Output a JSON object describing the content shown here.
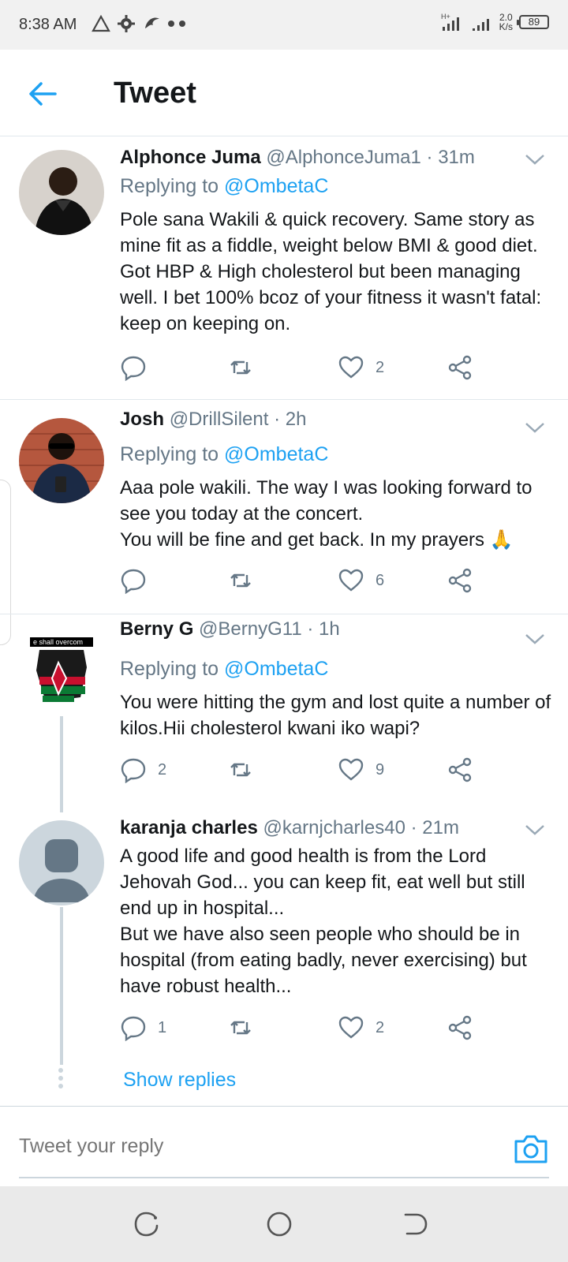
{
  "status_bar": {
    "time": "8:38 AM",
    "network": "H+",
    "speed_value": "2.0",
    "speed_unit": "K/s",
    "battery": "89"
  },
  "header": {
    "title": "Tweet",
    "back_icon": "arrow-left-icon"
  },
  "replying_label": "Replying to",
  "tweets": [
    {
      "name": "Alphonce Juma",
      "handle": "@AlphonceJuma1",
      "time": "· 31m",
      "mention": "@OmbetaC",
      "text": "Pole sana Wakili & quick recovery. Same story as mine fit as a fiddle, weight below BMI & good diet. Got HBP & High cholesterol but been managing well. I bet 100% bcoz of your fitness it wasn't fatal: keep on keeping on.",
      "replies": "",
      "likes": "2"
    },
    {
      "name": "Josh",
      "handle": "@DrillSilent",
      "time": "· 2h",
      "mention": "@OmbetaC",
      "text": "Aaa pole wakili. The way I was looking forward to see you today at the concert.\nYou will be fine and get back.  In my prayers 🙏",
      "replies": "",
      "likes": "6"
    },
    {
      "name": "Berny G",
      "handle": "@BernyG11",
      "time": "· 1h",
      "mention": "@OmbetaC",
      "avatar_caption": "e shall overcom",
      "text": "You were hitting the gym and lost quite a number of kilos.Hii cholesterol kwani iko wapi?",
      "replies": "2",
      "likes": "9"
    },
    {
      "name": "karanja charles",
      "handle": "@karnjcharles40",
      "time": "· 21m",
      "text": "A good life and good health is from the Lord Jehovah God... you can keep fit, eat well but still end up in hospital...\nBut we have also seen people who should be in hospital (from eating badly, never exercising) but have robust health...",
      "replies": "1",
      "likes": "2"
    }
  ],
  "show_replies": "Show replies",
  "reply_bar": {
    "placeholder": "Tweet your reply"
  },
  "colors": {
    "accent": "#1da1f2",
    "muted": "#657786",
    "text": "#14171a",
    "divider": "#e1e8ed"
  }
}
